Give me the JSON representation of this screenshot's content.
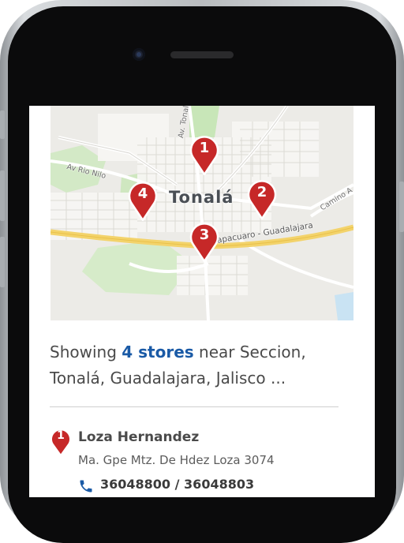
{
  "map": {
    "town": "Tonalá",
    "roads": {
      "av_tonaltecas": "Av. Tonaltecas",
      "av_rio_nilo": "Av Rio Nilo",
      "highway": "Zimapacuaro - Guadalajara",
      "camino": "Camino A"
    },
    "pins": [
      {
        "number": "1"
      },
      {
        "number": "2"
      },
      {
        "number": "3"
      },
      {
        "number": "4"
      }
    ],
    "pin_color": "#c62828"
  },
  "results": {
    "prefix": "Showing",
    "count": "4 stores",
    "suffix": "near Seccion, Tonalá, Guadalajara, Jalisco ..."
  },
  "stores": [
    {
      "number": "1",
      "name": "Loza Hernandez",
      "address": "Ma. Gpe Mtz. De Hdez Loza 3074",
      "phone": "36048800  /  36048803"
    }
  ],
  "colors": {
    "accent": "#1a5aa6",
    "pin": "#c62828"
  },
  "icons": {
    "store_phone": "phone-icon",
    "camera": "front-camera-icon"
  }
}
